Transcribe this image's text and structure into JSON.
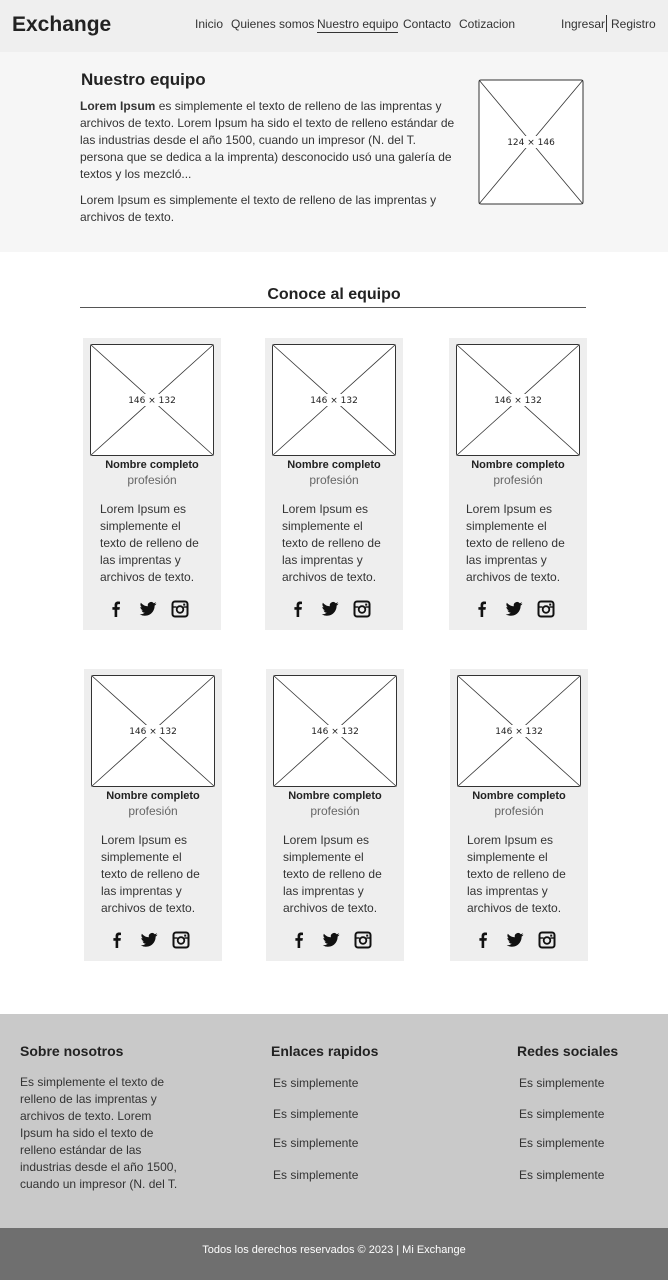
{
  "header": {
    "brand": "Exchange",
    "nav": [
      "Inicio",
      "Quienes somos",
      "Nuestro equipo",
      "Contacto",
      "Cotizacion"
    ],
    "active_nav": "Nuestro equipo",
    "login": "Ingresar",
    "register": "Registro"
  },
  "intro": {
    "title": "Nuestro equipo",
    "p1_bold": "Lorem Ipsum",
    "p1_rest": " es simplemente el texto de relleno de las imprentas y archivos de texto. Lorem Ipsum ha sido el texto de relleno estándar de las industrias desde el año 1500, cuando un impresor (N. del T. persona que se dedica a la imprenta) desconocido usó una galería de textos y los mezcló...",
    "p2": "Lorem Ipsum es simplemente el texto de relleno de las imprentas y archivos de texto.",
    "image_label": "124 × 146"
  },
  "team": {
    "title": "Conoce al equipo",
    "members": [
      {
        "image_label": "146 × 132",
        "name": "Nombre completo",
        "profession": "profesión",
        "description": "Lorem Ipsum es simplemente el texto de relleno de las imprentas y archivos de texto."
      },
      {
        "image_label": "146 × 132",
        "name": "Nombre completo",
        "profession": "profesión",
        "description": "Lorem Ipsum es simplemente el texto de relleno de las imprentas y archivos de texto."
      },
      {
        "image_label": "146 × 132",
        "name": "Nombre completo",
        "profession": "profesión",
        "description": "Lorem Ipsum es simplemente el texto de relleno de las imprentas y archivos de texto."
      },
      {
        "image_label": "146 × 132",
        "name": "Nombre completo",
        "profession": "profesión",
        "description": "Lorem Ipsum es simplemente el texto de relleno de las imprentas y archivos de texto."
      },
      {
        "image_label": "146 × 132",
        "name": "Nombre completo",
        "profession": "profesión",
        "description": "Lorem Ipsum es simplemente el texto de relleno de las imprentas y archivos de texto."
      },
      {
        "image_label": "146 × 132",
        "name": "Nombre completo",
        "profession": "profesión",
        "description": "Lorem Ipsum es simplemente el texto de relleno de las imprentas y archivos de texto."
      }
    ],
    "social_icons": [
      "facebook-icon",
      "twitter-icon",
      "instagram-icon"
    ]
  },
  "footer": {
    "about_title": "Sobre nosotros",
    "about_text": "Es simplemente el texto de relleno de las imprentas y archivos de texto. Lorem Ipsum ha sido el texto de relleno estándar de las industrias desde el año 1500, cuando un impresor (N. del T.",
    "links_title": "Enlaces rapidos",
    "links": [
      "Es simplemente",
      "Es simplemente",
      "Es simplemente",
      "Es simplemente"
    ],
    "social_title": "Redes sociales",
    "social_links": [
      "Es simplemente",
      "Es simplemente",
      "Es simplemente",
      "Es simplemente"
    ],
    "copyright": "Todos los derechos reservados © 2023 | Mi Exchange"
  },
  "colors": {
    "header_bg": "#efefef",
    "intro_bg": "#f6f6f6",
    "card_bg": "#eeeeee",
    "footer_bg": "#c9c9c9",
    "copyright_bg": "#6f6f6f"
  }
}
